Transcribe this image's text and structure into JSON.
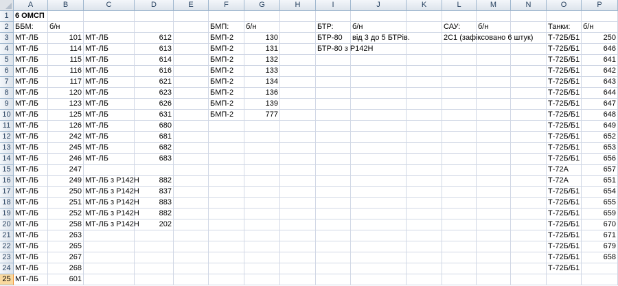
{
  "columns": [
    "A",
    "B",
    "C",
    "D",
    "E",
    "F",
    "G",
    "H",
    "I",
    "J",
    "K",
    "L",
    "M",
    "N",
    "O",
    "P"
  ],
  "rows": [
    {
      "n": "1",
      "cells": {
        "A": "6 ОМСП"
      }
    },
    {
      "n": "2",
      "cells": {
        "A": "ББМ:",
        "B": "б/н",
        "F": "БМП:",
        "G": "б/н",
        "I": "БТР:",
        "J": "б/н",
        "L": "САУ:",
        "M": "б/н",
        "O": "Танки:",
        "P": "б/н"
      }
    },
    {
      "n": "3",
      "cells": {
        "A": "МТ-ЛБ",
        "B": "101",
        "C": "МТ-ЛБ",
        "D": "612",
        "F": "БМП-2",
        "G": "130",
        "I": "БТР-80",
        "J": "від 3 до 5 БТРів.",
        "L": "2С1 (зафіксовано 6 штук)",
        "O": "Т-72Б/Б1",
        "P": "250"
      }
    },
    {
      "n": "4",
      "cells": {
        "A": "МТ-ЛБ",
        "B": "114",
        "C": "МТ-ЛБ",
        "D": "613",
        "F": "БМП-2",
        "G": "131",
        "I": "БТР-80 з Р142Н",
        "O": "Т-72Б/Б1",
        "P": "646"
      }
    },
    {
      "n": "5",
      "cells": {
        "A": "МТ-ЛБ",
        "B": "115",
        "C": "МТ-ЛБ",
        "D": "614",
        "F": "БМП-2",
        "G": "132",
        "O": "Т-72Б/Б1",
        "P": "641"
      }
    },
    {
      "n": "6",
      "cells": {
        "A": "МТ-ЛБ",
        "B": "116",
        "C": "МТ-ЛБ",
        "D": "616",
        "F": "БМП-2",
        "G": "133",
        "O": "Т-72Б/Б1",
        "P": "642"
      }
    },
    {
      "n": "7",
      "cells": {
        "A": "МТ-ЛБ",
        "B": "117",
        "C": "МТ-ЛБ",
        "D": "621",
        "F": "БМП-2",
        "G": "134",
        "O": "Т-72Б/Б1",
        "P": "643"
      }
    },
    {
      "n": "8",
      "cells": {
        "A": "МТ-ЛБ",
        "B": "120",
        "C": "МТ-ЛБ",
        "D": "623",
        "F": "БМП-2",
        "G": "136",
        "O": "Т-72Б/Б1",
        "P": "644"
      }
    },
    {
      "n": "9",
      "cells": {
        "A": "МТ-ЛБ",
        "B": "123",
        "C": "МТ-ЛБ",
        "D": "626",
        "F": "БМП-2",
        "G": "139",
        "O": "Т-72Б/Б1",
        "P": "647"
      }
    },
    {
      "n": "10",
      "cells": {
        "A": "МТ-ЛБ",
        "B": "125",
        "C": "МТ-ЛБ",
        "D": "631",
        "F": "БМП-2",
        "G": "777",
        "O": "Т-72Б/Б1",
        "P": "648"
      }
    },
    {
      "n": "11",
      "cells": {
        "A": "МТ-ЛБ",
        "B": "126",
        "C": "МТ-ЛБ",
        "D": "680",
        "O": "Т-72Б/Б1",
        "P": "649"
      }
    },
    {
      "n": "12",
      "cells": {
        "A": "МТ-ЛБ",
        "B": "242",
        "C": "МТ-ЛБ",
        "D": "681",
        "O": "Т-72Б/Б1",
        "P": "652"
      }
    },
    {
      "n": "13",
      "cells": {
        "A": "МТ-ЛБ",
        "B": "245",
        "C": "МТ-ЛБ",
        "D": "682",
        "O": "Т-72Б/Б1",
        "P": "653"
      }
    },
    {
      "n": "14",
      "cells": {
        "A": "МТ-ЛБ",
        "B": "246",
        "C": "МТ-ЛБ",
        "D": "683",
        "O": "Т-72Б/Б1",
        "P": "656"
      }
    },
    {
      "n": "15",
      "cells": {
        "A": "МТ-ЛБ",
        "B": "247",
        "O": "Т-72А",
        "P": "657"
      }
    },
    {
      "n": "16",
      "cells": {
        "A": "МТ-ЛБ",
        "B": "249",
        "C": "МТ-ЛБ з Р142Н",
        "D": "882",
        "O": "Т-72А",
        "P": "651"
      }
    },
    {
      "n": "17",
      "cells": {
        "A": "МТ-ЛБ",
        "B": "250",
        "C": "МТ-ЛБ з Р142Н",
        "D": "837",
        "O": "Т-72Б/Б1",
        "P": "654"
      }
    },
    {
      "n": "18",
      "cells": {
        "A": "МТ-ЛБ",
        "B": "251",
        "C": "МТ-ЛБ з Р142Н",
        "D": "883",
        "O": "Т-72Б/Б1",
        "P": "655"
      }
    },
    {
      "n": "19",
      "cells": {
        "A": "МТ-ЛБ",
        "B": "252",
        "C": "МТ-ЛБ з Р142Н",
        "D": "882",
        "O": "Т-72Б/Б1",
        "P": "659"
      }
    },
    {
      "n": "20",
      "cells": {
        "A": "МТ-ЛБ",
        "B": "258",
        "C": "МТ-ЛБ з Р142Н",
        "D": "202",
        "O": "Т-72Б/Б1",
        "P": "670"
      }
    },
    {
      "n": "21",
      "cells": {
        "A": "МТ-ЛБ",
        "B": "263",
        "O": "Т-72Б/Б1",
        "P": "671"
      }
    },
    {
      "n": "22",
      "cells": {
        "A": "МТ-ЛБ",
        "B": "265",
        "O": "Т-72Б/Б1",
        "P": "679"
      }
    },
    {
      "n": "23",
      "cells": {
        "A": "МТ-ЛБ",
        "B": "267",
        "O": "Т-72Б/Б1",
        "P": "658"
      }
    },
    {
      "n": "24",
      "cells": {
        "A": "МТ-ЛБ",
        "B": "268",
        "O": "Т-72Б/Б1"
      }
    },
    {
      "n": "25",
      "cells": {
        "A": "МТ-ЛБ",
        "B": "601"
      }
    }
  ]
}
